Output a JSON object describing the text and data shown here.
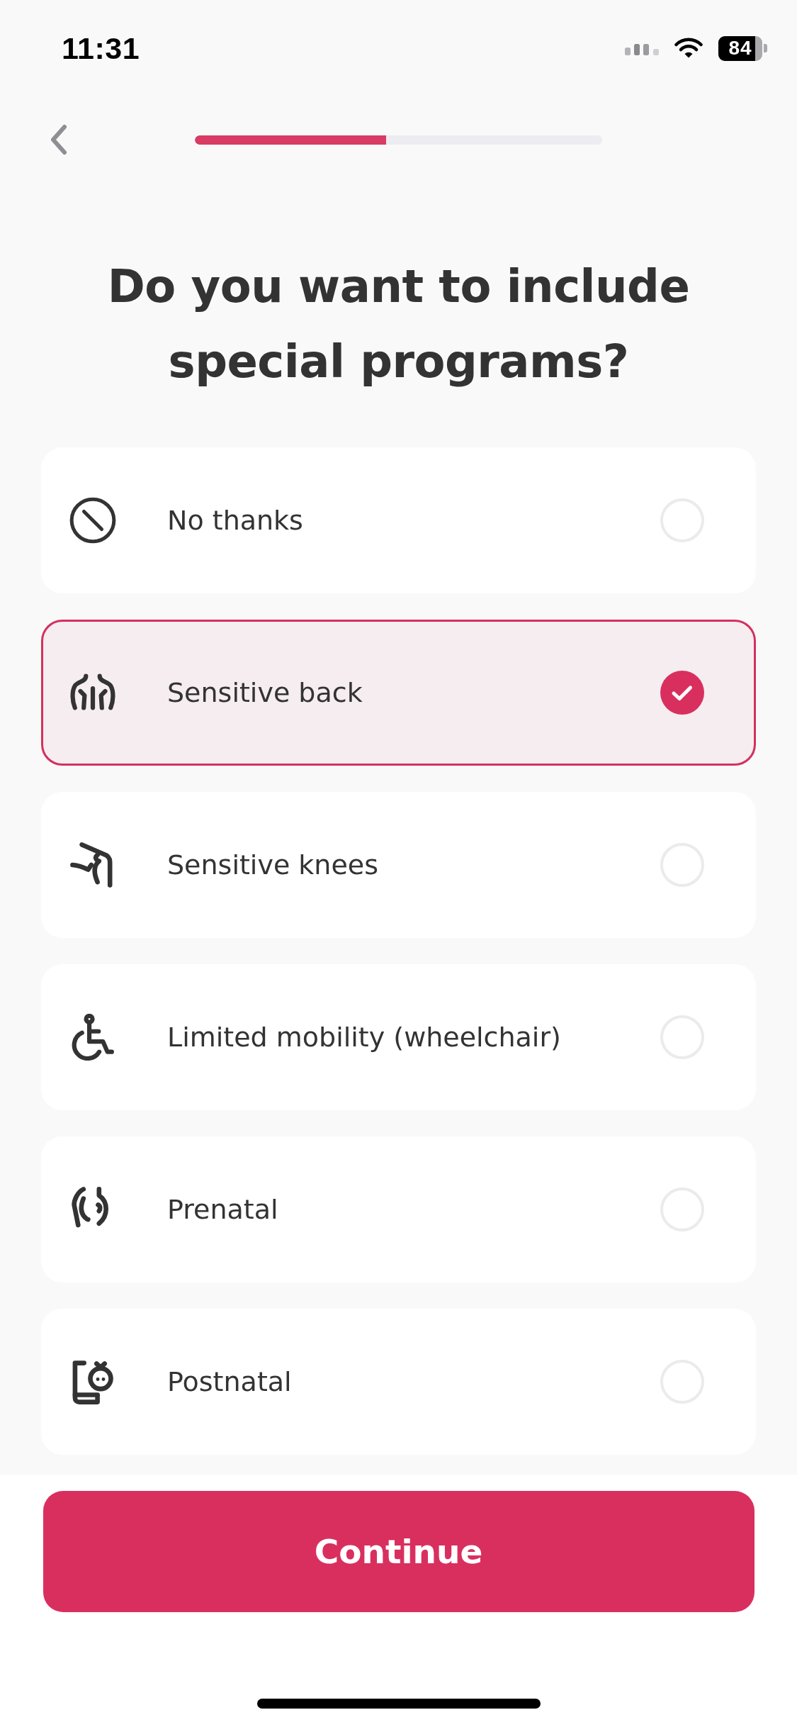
{
  "status_bar": {
    "time": "11:31",
    "battery": "84"
  },
  "header": {
    "progress": {
      "level": 0.47
    }
  },
  "title": "Do you want to include special programs?",
  "options": [
    {
      "label": "No thanks",
      "selected": false
    },
    {
      "label": "Sensitive back",
      "selected": true
    },
    {
      "label": "Sensitive knees",
      "selected": false
    },
    {
      "label": "Limited mobility (wheelchair)",
      "selected": false
    },
    {
      "label": "Prenatal",
      "selected": false
    },
    {
      "label": "Postnatal",
      "selected": false
    }
  ],
  "continue_button": {
    "label": "Continue"
  }
}
